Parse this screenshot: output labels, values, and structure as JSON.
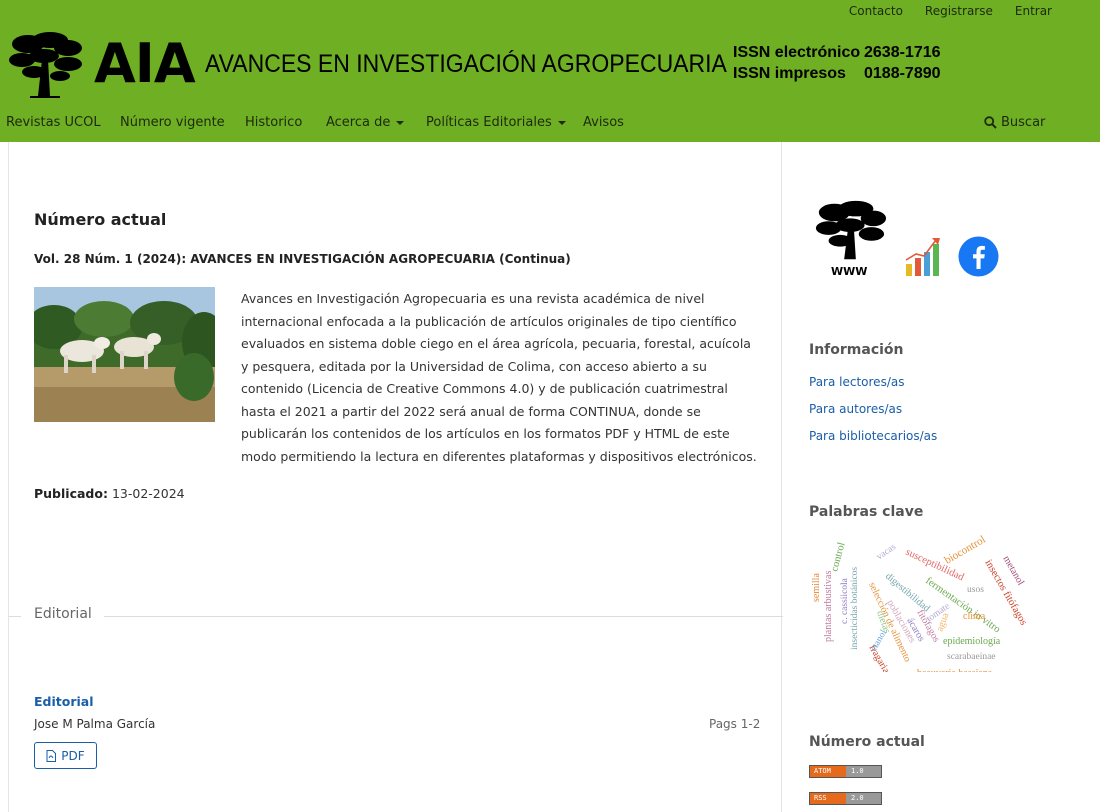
{
  "header": {
    "top_links": [
      "Contacto",
      "Registrarse",
      "Entrar"
    ],
    "logo_acronym": "AIA",
    "journal_name": "AVANCES EN INVESTIGACIÓN AGROPECUARIA",
    "issn": [
      {
        "label": "ISSN electrónico",
        "value": "2638-1716"
      },
      {
        "label": "ISSN impresos",
        "value": "0188-7890"
      }
    ],
    "nav": {
      "revistas": "Revistas UCOL",
      "numero_vigente": "Número vigente",
      "historico": "Historico",
      "acerca": "Acerca de",
      "politicas": "Políticas Editoriales",
      "avisos": "Avisos",
      "buscar": "Buscar"
    }
  },
  "main": {
    "heading": "Número actual",
    "issue_title": "Vol. 28 Núm. 1 (2024): AVANCES EN INVESTIGACIÓN AGROPECUARIA (Continua)",
    "description": "Avances en Investigación Agropecuaria es una revista académica de nivel internacional enfocada a la publicación de artículos originales de tipo científico evaluados en sistema doble ciego en el área agrícola, pecuaria, forestal, acuícola y pesquera, editada por la Universidad de Colima, con acceso abierto a su contenido (Licencia de Creative Commons 4.0) y de publicación cuatrimestral hasta el 2021 a partir del 2022 será anual de forma CONTINUA, donde se publicarán los contenidos de los artículos en los formatos PDF y HTML de este modo permitiendo la lectura en diferentes plataformas y dispositivos electrónicos.",
    "published_label": "Publicado:",
    "published_date": "13-02-2024",
    "section": "Editorial",
    "article": {
      "title": "Editorial",
      "author": "Jose M Palma García",
      "pages": "Pags 1-2",
      "pdf_label": "PDF"
    }
  },
  "sidebar": {
    "www_label": "WWW",
    "info_heading": "Información",
    "info_links": [
      "Para lectores/as",
      "Para autores/as",
      "Para bibliotecarios/as"
    ],
    "keywords_heading": "Palabras clave",
    "keywords": [
      {
        "word": "semilla",
        "color": "#e4893b"
      },
      {
        "word": "control",
        "color": "#6aa84f"
      },
      {
        "word": "plantas arbustivas",
        "color": "#c27ba0"
      },
      {
        "word": "c. cassiicola",
        "color": "#8e7cc3"
      },
      {
        "word": "insecticidas botánicos",
        "color": "#76a5af"
      },
      {
        "word": "selección de alimento",
        "color": "#e69138"
      },
      {
        "word": "dietas",
        "color": "#93c47d"
      },
      {
        "word": "fragaria spp",
        "color": "#cc4125"
      },
      {
        "word": "etanol",
        "color": "#6fa8dc"
      },
      {
        "word": "vacas",
        "color": "#b4a7d6"
      },
      {
        "word": "digestibilidad",
        "color": "#76a5af"
      },
      {
        "word": "poblaciones",
        "color": "#d5a6bd"
      },
      {
        "word": "ácaros",
        "color": "#8e7cc3"
      },
      {
        "word": "susceptibilidad",
        "color": "#e06666"
      },
      {
        "word": "fermentación in vitro",
        "color": "#6aa84f"
      },
      {
        "word": "fitófagos",
        "color": "#c27ba0"
      },
      {
        "word": "tomate",
        "color": "#b4a7d6"
      },
      {
        "word": "agua",
        "color": "#f6b26b"
      },
      {
        "word": "biocontrol",
        "color": "#e69138"
      },
      {
        "word": "usos",
        "color": "#999999"
      },
      {
        "word": "clima",
        "color": "#e69138"
      },
      {
        "word": "epidemiología",
        "color": "#6aa84f"
      },
      {
        "word": "scarabaeinae",
        "color": "#999999"
      },
      {
        "word": "beauveria bassiana",
        "color": "#e69138"
      },
      {
        "word": "insectos fitófagos",
        "color": "#cc4125"
      },
      {
        "word": "metanol",
        "color": "#a64d79"
      }
    ],
    "current_heading": "Número actual",
    "feeds": [
      {
        "left": "ATOM",
        "right": "1.0"
      },
      {
        "left": "RSS",
        "right": "2.0"
      }
    ]
  }
}
